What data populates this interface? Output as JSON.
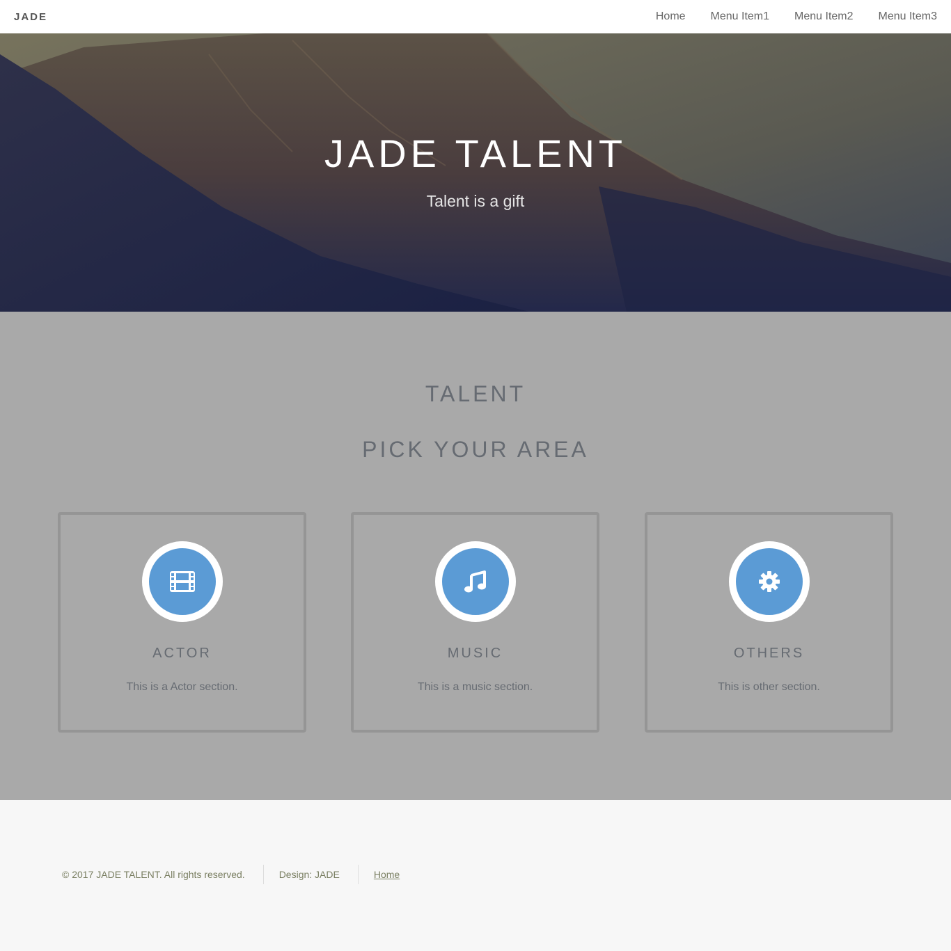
{
  "brand": "JADE",
  "nav": [
    "Home",
    "Menu Item1",
    "Menu Item2",
    "Menu Item3"
  ],
  "hero": {
    "title": "JADE TALENT",
    "subtitle": "Talent is a gift"
  },
  "talent": {
    "title": "TALENT",
    "subtitle": "PICK YOUR AREA",
    "accent_color": "#5b9bd5",
    "cards": [
      {
        "icon": "film-icon",
        "title": "ACTOR",
        "text": "This is a Actor section."
      },
      {
        "icon": "music-icon",
        "title": "MUSIC",
        "text": "This is a music section."
      },
      {
        "icon": "gear-icon",
        "title": "OTHERS",
        "text": "This is other section."
      }
    ]
  },
  "footer": {
    "copyright": "© 2017 JADE TALENT. All rights reserved.",
    "design": "Design: JADE",
    "link": "Home"
  }
}
